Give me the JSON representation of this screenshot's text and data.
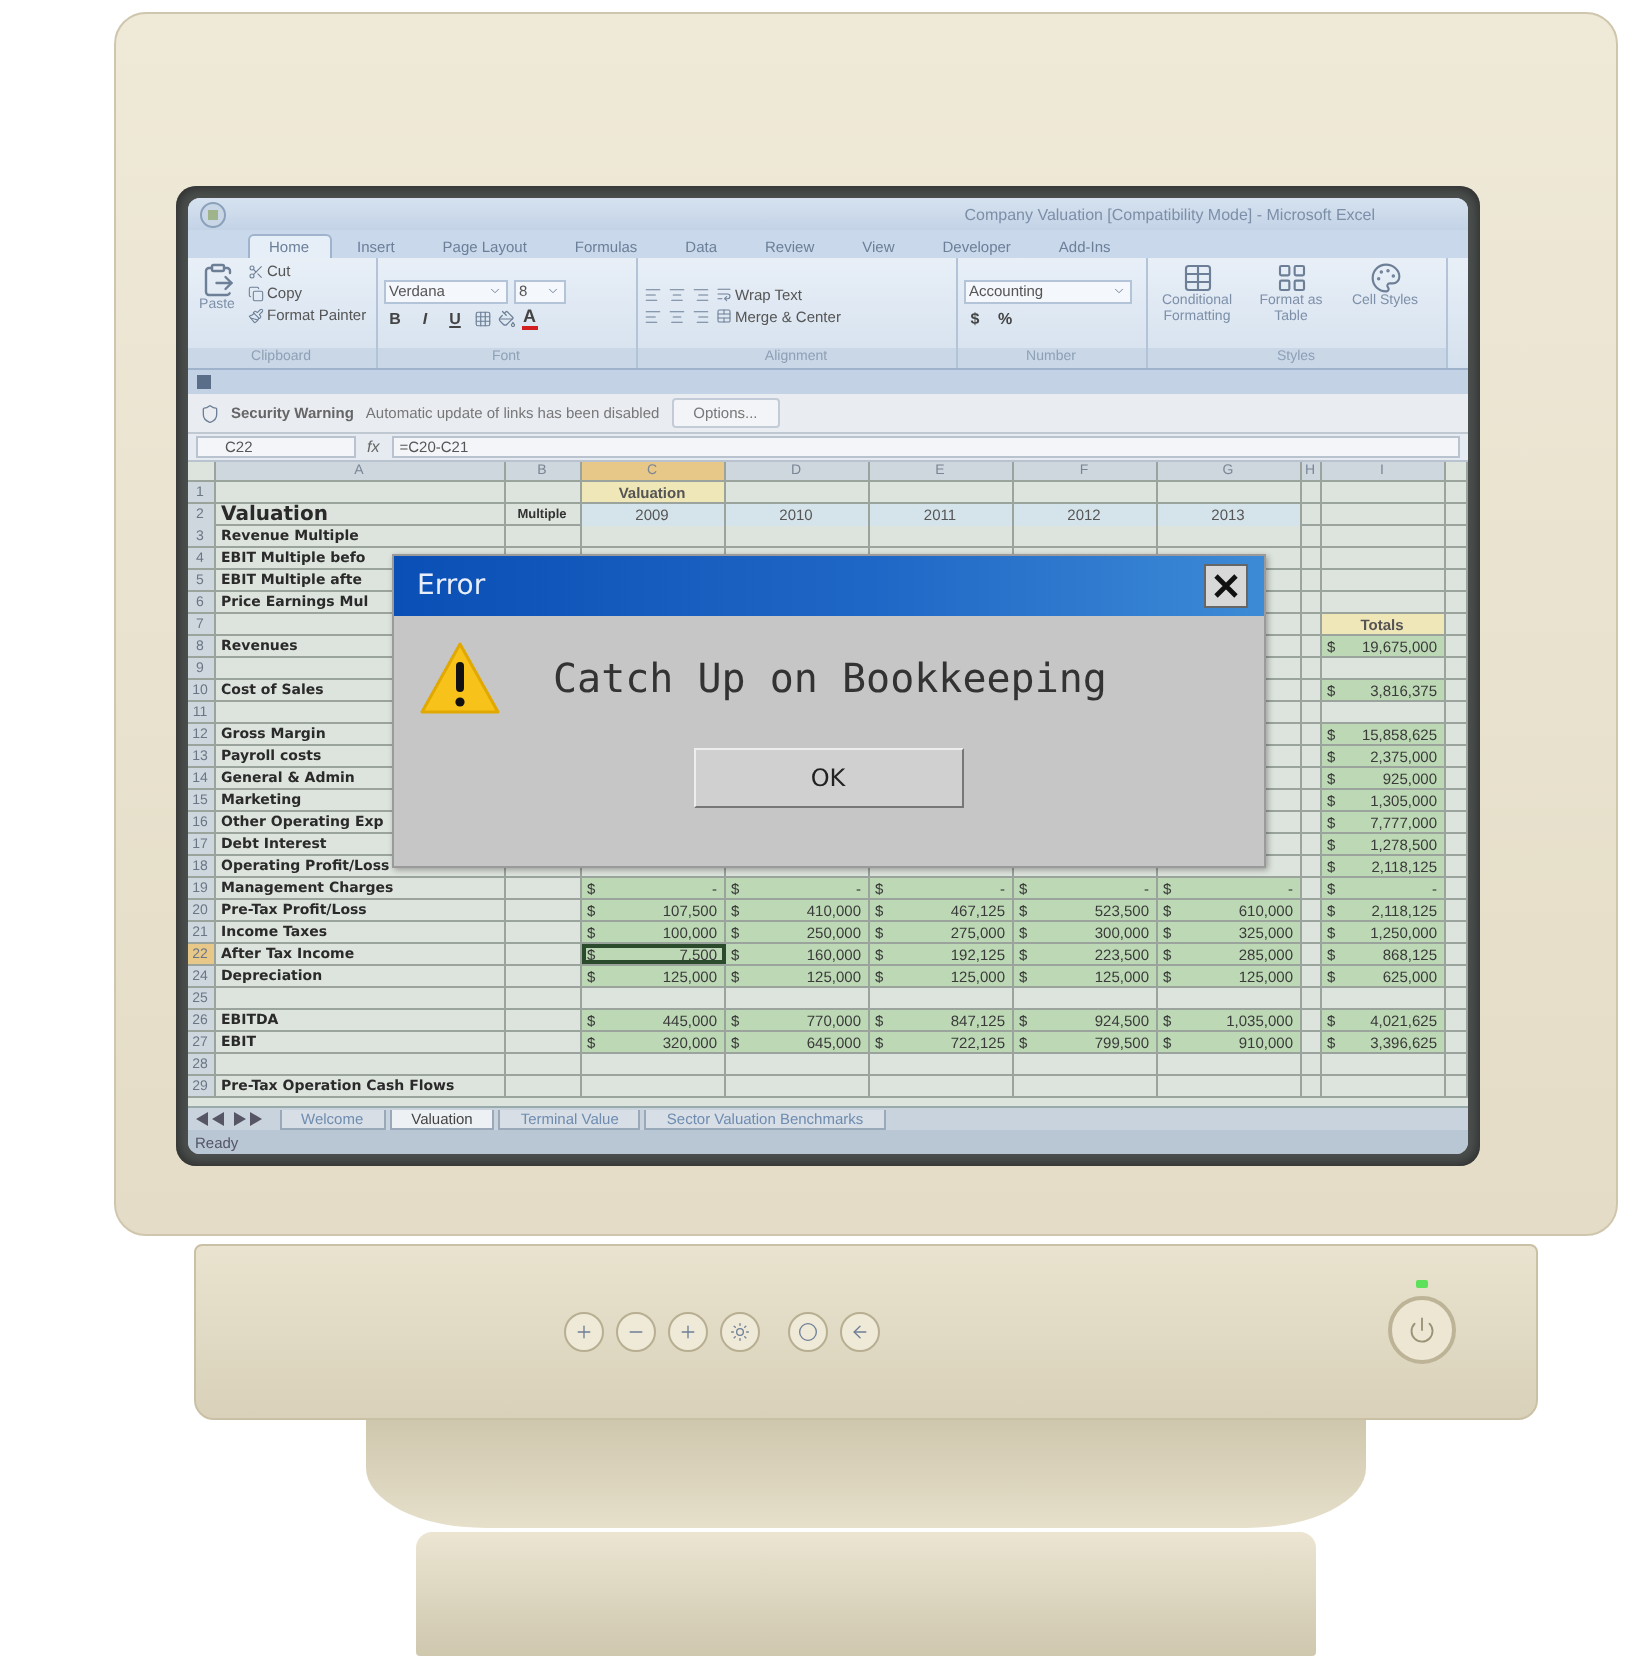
{
  "window": {
    "title": "Company Valuation  [Compatibility Mode] - Microsoft Excel"
  },
  "ribbon_tabs": [
    {
      "label": "Home",
      "selected": true
    },
    {
      "label": "Insert",
      "selected": false
    },
    {
      "label": "Page Layout",
      "selected": false
    },
    {
      "label": "Formulas",
      "selected": false
    },
    {
      "label": "Data",
      "selected": false
    },
    {
      "label": "Review",
      "selected": false
    },
    {
      "label": "View",
      "selected": false
    },
    {
      "label": "Developer",
      "selected": false
    },
    {
      "label": "Add-Ins",
      "selected": false
    }
  ],
  "ribbon": {
    "clipboard": {
      "label": "Clipboard",
      "paste": "Paste",
      "commands": [
        "Cut",
        "Copy",
        "Format Painter"
      ]
    },
    "font": {
      "label": "Font",
      "family": "Verdana",
      "size": "8",
      "styles": [
        "B",
        "I",
        "U"
      ],
      "color_letter": "A"
    },
    "alignment": {
      "label": "Alignment",
      "commands": [
        "Wrap Text",
        "Merge & Center"
      ]
    },
    "number": {
      "label": "Number",
      "format": "Accounting",
      "symbols": [
        "$",
        "%"
      ]
    },
    "styles": {
      "label": "Styles",
      "commands": [
        "Conditional Formatting",
        "Format as Table",
        "Cell Styles"
      ]
    }
  },
  "security_bar": {
    "title": "Security Warning",
    "message": "Automatic update of links has been disabled",
    "button": "Options..."
  },
  "formula_bar": {
    "name_box": "C22",
    "fx": "fx",
    "formula": "=C20-C21"
  },
  "columns": [
    {
      "label": "A",
      "selected": false
    },
    {
      "label": "B",
      "selected": false
    },
    {
      "label": "C",
      "selected": true
    },
    {
      "label": "D",
      "selected": false
    },
    {
      "label": "E",
      "selected": false
    },
    {
      "label": "F",
      "selected": false
    },
    {
      "label": "G",
      "selected": false
    },
    {
      "label": "H",
      "selected": false
    },
    {
      "label": "I",
      "selected": false
    }
  ],
  "rows": [
    {
      "number": "1",
      "selected": false,
      "values": [
        {
          "kind": "header",
          "text": "Valuation"
        }
      ]
    },
    {
      "number": "2",
      "selected": false,
      "label": "Valuation",
      "heading": true,
      "multiple": "Multiple",
      "values": [
        {
          "kind": "year",
          "text": "2009"
        },
        {
          "kind": "year",
          "text": "2010"
        },
        {
          "kind": "year",
          "text": "2011"
        },
        {
          "kind": "year",
          "text": "2012"
        },
        {
          "kind": "year",
          "text": "2013"
        }
      ]
    },
    {
      "number": "3",
      "selected": false,
      "label": "Revenue Multiple",
      "heading": false
    },
    {
      "number": "4",
      "selected": false,
      "label": "EBIT Multiple befo",
      "heading": false
    },
    {
      "number": "5",
      "selected": false,
      "label": "EBIT Multiple afte",
      "heading": false
    },
    {
      "number": "6",
      "selected": false,
      "label": "Price Earnings Mul",
      "heading": false
    },
    {
      "number": "7",
      "selected": false,
      "total": {
        "kind": "header",
        "text": "Totals"
      }
    },
    {
      "number": "8",
      "selected": false,
      "label": "Revenues",
      "heading": false,
      "total": {
        "kind": "money",
        "sign": "$",
        "amount": "19,675,000"
      }
    },
    {
      "number": "9",
      "selected": false
    },
    {
      "number": "10",
      "selected": false,
      "label": "Cost of Sales",
      "heading": false,
      "total": {
        "kind": "money",
        "sign": "$",
        "amount": "3,816,375"
      }
    },
    {
      "number": "11",
      "selected": false
    },
    {
      "number": "12",
      "selected": false,
      "label": "Gross Margin",
      "heading": false,
      "total": {
        "kind": "money",
        "sign": "$",
        "amount": "15,858,625"
      }
    },
    {
      "number": "13",
      "selected": false,
      "label": "Payroll costs",
      "heading": false,
      "total": {
        "kind": "money",
        "sign": "$",
        "amount": "2,375,000"
      }
    },
    {
      "number": "14",
      "selected": false,
      "label": "General & Admin",
      "heading": false,
      "total": {
        "kind": "money",
        "sign": "$",
        "amount": "925,000"
      }
    },
    {
      "number": "15",
      "selected": false,
      "label": "Marketing",
      "heading": false,
      "total": {
        "kind": "money",
        "sign": "$",
        "amount": "1,305,000"
      }
    },
    {
      "number": "16",
      "selected": false,
      "label": "Other Operating Exp",
      "heading": false,
      "total": {
        "kind": "money",
        "sign": "$",
        "amount": "7,777,000"
      }
    },
    {
      "number": "17",
      "selected": false,
      "label": "Debt Interest",
      "heading": false,
      "total": {
        "kind": "money",
        "sign": "$",
        "amount": "1,278,500"
      }
    },
    {
      "number": "18",
      "selected": false,
      "label": "Operating Profit/Loss",
      "heading": false,
      "total": {
        "kind": "money",
        "sign": "$",
        "amount": "2,118,125"
      }
    },
    {
      "number": "19",
      "selected": false,
      "label": "Management Charges",
      "heading": false,
      "values": [
        {
          "kind": "money",
          "sign": "$",
          "amount": "-"
        },
        {
          "kind": "money",
          "sign": "$",
          "amount": "-"
        },
        {
          "kind": "money",
          "sign": "$",
          "amount": "-"
        },
        {
          "kind": "money",
          "sign": "$",
          "amount": "-"
        },
        {
          "kind": "money",
          "sign": "$",
          "amount": "-"
        }
      ],
      "total": {
        "kind": "money",
        "sign": "$",
        "amount": "-"
      }
    },
    {
      "number": "20",
      "selected": false,
      "label": "Pre-Tax Profit/Loss",
      "heading": false,
      "values": [
        {
          "kind": "money",
          "sign": "$",
          "amount": "107,500"
        },
        {
          "kind": "money",
          "sign": "$",
          "amount": "410,000"
        },
        {
          "kind": "money",
          "sign": "$",
          "amount": "467,125"
        },
        {
          "kind": "money",
          "sign": "$",
          "amount": "523,500"
        },
        {
          "kind": "money",
          "sign": "$",
          "amount": "610,000"
        }
      ],
      "total": {
        "kind": "money",
        "sign": "$",
        "amount": "2,118,125"
      }
    },
    {
      "number": "21",
      "selected": false,
      "label": "Income Taxes",
      "heading": false,
      "values": [
        {
          "kind": "money",
          "sign": "$",
          "amount": "100,000"
        },
        {
          "kind": "money",
          "sign": "$",
          "amount": "250,000"
        },
        {
          "kind": "money",
          "sign": "$",
          "amount": "275,000"
        },
        {
          "kind": "money",
          "sign": "$",
          "amount": "300,000"
        },
        {
          "kind": "money",
          "sign": "$",
          "amount": "325,000"
        }
      ],
      "total": {
        "kind": "money",
        "sign": "$",
        "amount": "1,250,000"
      }
    },
    {
      "number": "22",
      "selected": true,
      "label": "After Tax Income",
      "heading": false,
      "values": [
        {
          "kind": "money",
          "sign": "$",
          "amount": "7,500"
        },
        {
          "kind": "money",
          "sign": "$",
          "amount": "160,000"
        },
        {
          "kind": "money",
          "sign": "$",
          "amount": "192,125"
        },
        {
          "kind": "money",
          "sign": "$",
          "amount": "223,500"
        },
        {
          "kind": "money",
          "sign": "$",
          "amount": "285,000"
        }
      ],
      "total": {
        "kind": "money",
        "sign": "$",
        "amount": "868,125"
      }
    },
    {
      "number": "24",
      "selected": false,
      "label": "Depreciation",
      "heading": false,
      "values": [
        {
          "kind": "money",
          "sign": "$",
          "amount": "125,000"
        },
        {
          "kind": "money",
          "sign": "$",
          "amount": "125,000"
        },
        {
          "kind": "money",
          "sign": "$",
          "amount": "125,000"
        },
        {
          "kind": "money",
          "sign": "$",
          "amount": "125,000"
        },
        {
          "kind": "money",
          "sign": "$",
          "amount": "125,000"
        }
      ],
      "total": {
        "kind": "money",
        "sign": "$",
        "amount": "625,000"
      }
    },
    {
      "number": "25",
      "selected": false
    },
    {
      "number": "26",
      "selected": false,
      "label": "EBITDA",
      "heading": false,
      "values": [
        {
          "kind": "money",
          "sign": "$",
          "amount": "445,000"
        },
        {
          "kind": "money",
          "sign": "$",
          "amount": "770,000"
        },
        {
          "kind": "money",
          "sign": "$",
          "amount": "847,125"
        },
        {
          "kind": "money",
          "sign": "$",
          "amount": "924,500"
        },
        {
          "kind": "money",
          "sign": "$",
          "amount": "1,035,000"
        }
      ],
      "total": {
        "kind": "money",
        "sign": "$",
        "amount": "4,021,625"
      }
    },
    {
      "number": "27",
      "selected": false,
      "label": "EBIT",
      "heading": false,
      "values": [
        {
          "kind": "money",
          "sign": "$",
          "amount": "320,000"
        },
        {
          "kind": "money",
          "sign": "$",
          "amount": "645,000"
        },
        {
          "kind": "money",
          "sign": "$",
          "amount": "722,125"
        },
        {
          "kind": "money",
          "sign": "$",
          "amount": "799,500"
        },
        {
          "kind": "money",
          "sign": "$",
          "amount": "910,000"
        }
      ],
      "total": {
        "kind": "money",
        "sign": "$",
        "amount": "3,396,625"
      }
    },
    {
      "number": "28",
      "selected": false
    },
    {
      "number": "29",
      "selected": false,
      "label": "Pre-Tax Operation Cash Flows",
      "heading": false
    }
  ],
  "sheet_tabs": [
    {
      "label": "Welcome",
      "selected": false
    },
    {
      "label": "Valuation",
      "selected": true
    },
    {
      "label": "Terminal Value",
      "selected": false
    },
    {
      "label": "Sector Valuation Benchmarks",
      "selected": false
    }
  ],
  "status": "Ready",
  "dialog": {
    "title": "Error",
    "message": "Catch Up on Bookkeeping",
    "button": "OK"
  }
}
